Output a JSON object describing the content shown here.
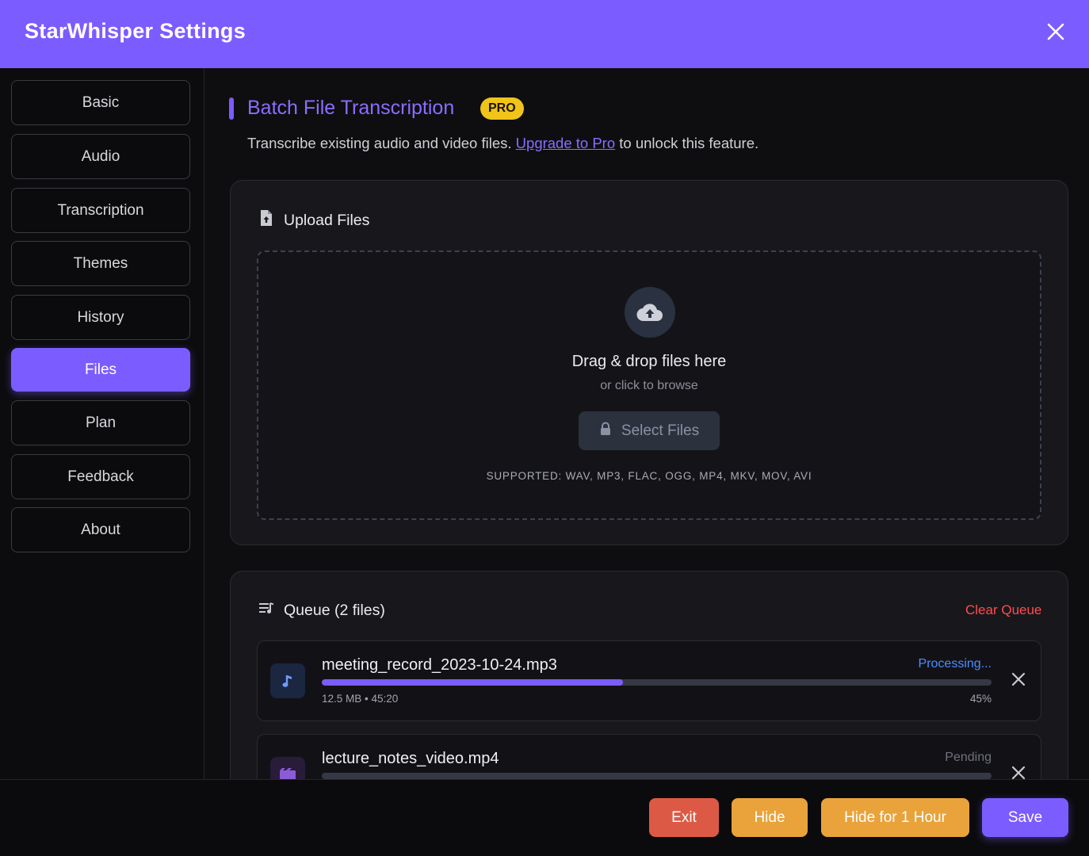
{
  "window": {
    "title": "StarWhisper Settings",
    "close_icon": "close-icon"
  },
  "sidebar": {
    "items": [
      {
        "label": "Basic",
        "active": false
      },
      {
        "label": "Audio",
        "active": false
      },
      {
        "label": "Transcription",
        "active": false
      },
      {
        "label": "Themes",
        "active": false
      },
      {
        "label": "History",
        "active": false
      },
      {
        "label": "Files",
        "active": true
      },
      {
        "label": "Plan",
        "active": false
      },
      {
        "label": "Feedback",
        "active": false
      },
      {
        "label": "About",
        "active": false
      }
    ]
  },
  "section": {
    "title": "Batch File Transcription",
    "badge": "PRO",
    "desc_before": "Transcribe existing audio and video files.",
    "desc_link": "Upgrade to Pro",
    "desc_after": "to unlock this feature."
  },
  "upload": {
    "heading": "Upload Files",
    "icon": "file-upload-icon",
    "drop_icon": "cloud-upload-icon",
    "drop_title": "Drag & drop files here",
    "drop_subtitle": "or click to browse",
    "select_button": "Select Files",
    "select_icon": "lock-icon",
    "supported": "SUPPORTED: WAV, MP3, FLAC, OGG, MP4, MKV, MOV, AVI"
  },
  "queue": {
    "heading": "Queue (2 files)",
    "icon": "queue-icon",
    "clear_label": "Clear Queue",
    "items": [
      {
        "name": "meeting_record_2023-10-24.mp3",
        "status": "Processing...",
        "meta": "12.5 MB • 45:20",
        "progress": 0.45,
        "percent": "45%",
        "icon": "music-note-icon"
      },
      {
        "name": "lecture_notes_video.mp4",
        "status": "Pending",
        "progress": 0,
        "icon": "video-icon"
      }
    ]
  },
  "footer": {
    "exit": "Exit",
    "hide": "Hide",
    "hide_hour": "Hide for 1 Hour",
    "save": "Save"
  },
  "colors": {
    "accent": "#7b5cff",
    "pro_badge": "#f0c419",
    "exit": "#dc5a45",
    "hide": "#e9a33a",
    "processing": "#4c8dff",
    "danger": "#ff4d4d"
  }
}
